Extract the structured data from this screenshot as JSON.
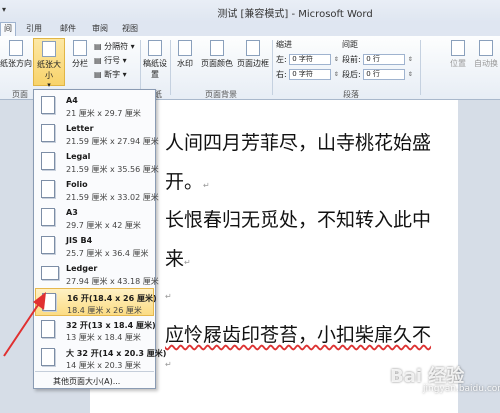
{
  "window": {
    "title": "测试 [兼容模式] - Microsoft Word",
    "qa_dropdown": "▾"
  },
  "tabs": [
    "间",
    "引用",
    "邮件",
    "审阅",
    "视图"
  ],
  "ribbon": {
    "orientation_label": "纸张方向",
    "size_label": "纸张大小",
    "columns_label": "分栏",
    "breaks_label": "分隔符",
    "line_numbers_label": "行号",
    "hyphenation_label": "断字",
    "draft_label": "稿纸设置",
    "watermark_label": "水印",
    "page_color_label": "页面颜色",
    "page_border_label": "页面边框",
    "group_page": "页面",
    "group_draft": "稿纸",
    "group_background": "页面背景",
    "group_paragraph": "段落",
    "indent_title": "缩进",
    "indent_left_label": "左:",
    "indent_left_value": "0 字符",
    "indent_right_label": "右:",
    "indent_right_value": "0 字符",
    "spacing_title": "间距",
    "spacing_before_label": "段前:",
    "spacing_before_value": "0 行",
    "spacing_after_label": "段后:",
    "spacing_after_value": "0 行",
    "position_label": "位置",
    "wrap_label": "自动换"
  },
  "paper_sizes": [
    {
      "name": "A4",
      "dims": "21 厘米 x 29.7 厘米"
    },
    {
      "name": "Letter",
      "dims": "21.59 厘米 x 27.94 厘米"
    },
    {
      "name": "Legal",
      "dims": "21.59 厘米 x 35.56 厘米"
    },
    {
      "name": "Folio",
      "dims": "21.59 厘米 x 33.02 厘米"
    },
    {
      "name": "A3",
      "dims": "29.7 厘米 x 42 厘米"
    },
    {
      "name": "JIS B4",
      "dims": "25.7 厘米 x 36.4 厘米"
    },
    {
      "name": "Ledger",
      "dims": "27.94 厘米 x 43.18 厘米"
    },
    {
      "name": "16 开(18.4 x 26 厘米)",
      "dims": "18.4 厘米 x 26 厘米"
    },
    {
      "name": "32 开(13 x 18.4 厘米)",
      "dims": "13 厘米 x 18.4 厘米"
    },
    {
      "name": "大 32 开(14 x 20.3 厘米)",
      "dims": "14 厘米 x 20.3 厘米"
    }
  ],
  "more_sizes_label": "其他页面大小(A)...",
  "document": {
    "line1": "人间四月芳菲尽，山寺桃花始盛",
    "line2": "开。",
    "line3": "长恨春归无觅处，不知转入此中",
    "line4": "来",
    "line5": "应怜屐齿印苍苔，小扣柴扉久不",
    "para_mark": "↵"
  },
  "watermark": {
    "text": "Bai 经验",
    "sub": "jingyan.baidu.com"
  },
  "colors": {
    "selected_bg": "#fbdc84",
    "arrow": "#e03030"
  }
}
